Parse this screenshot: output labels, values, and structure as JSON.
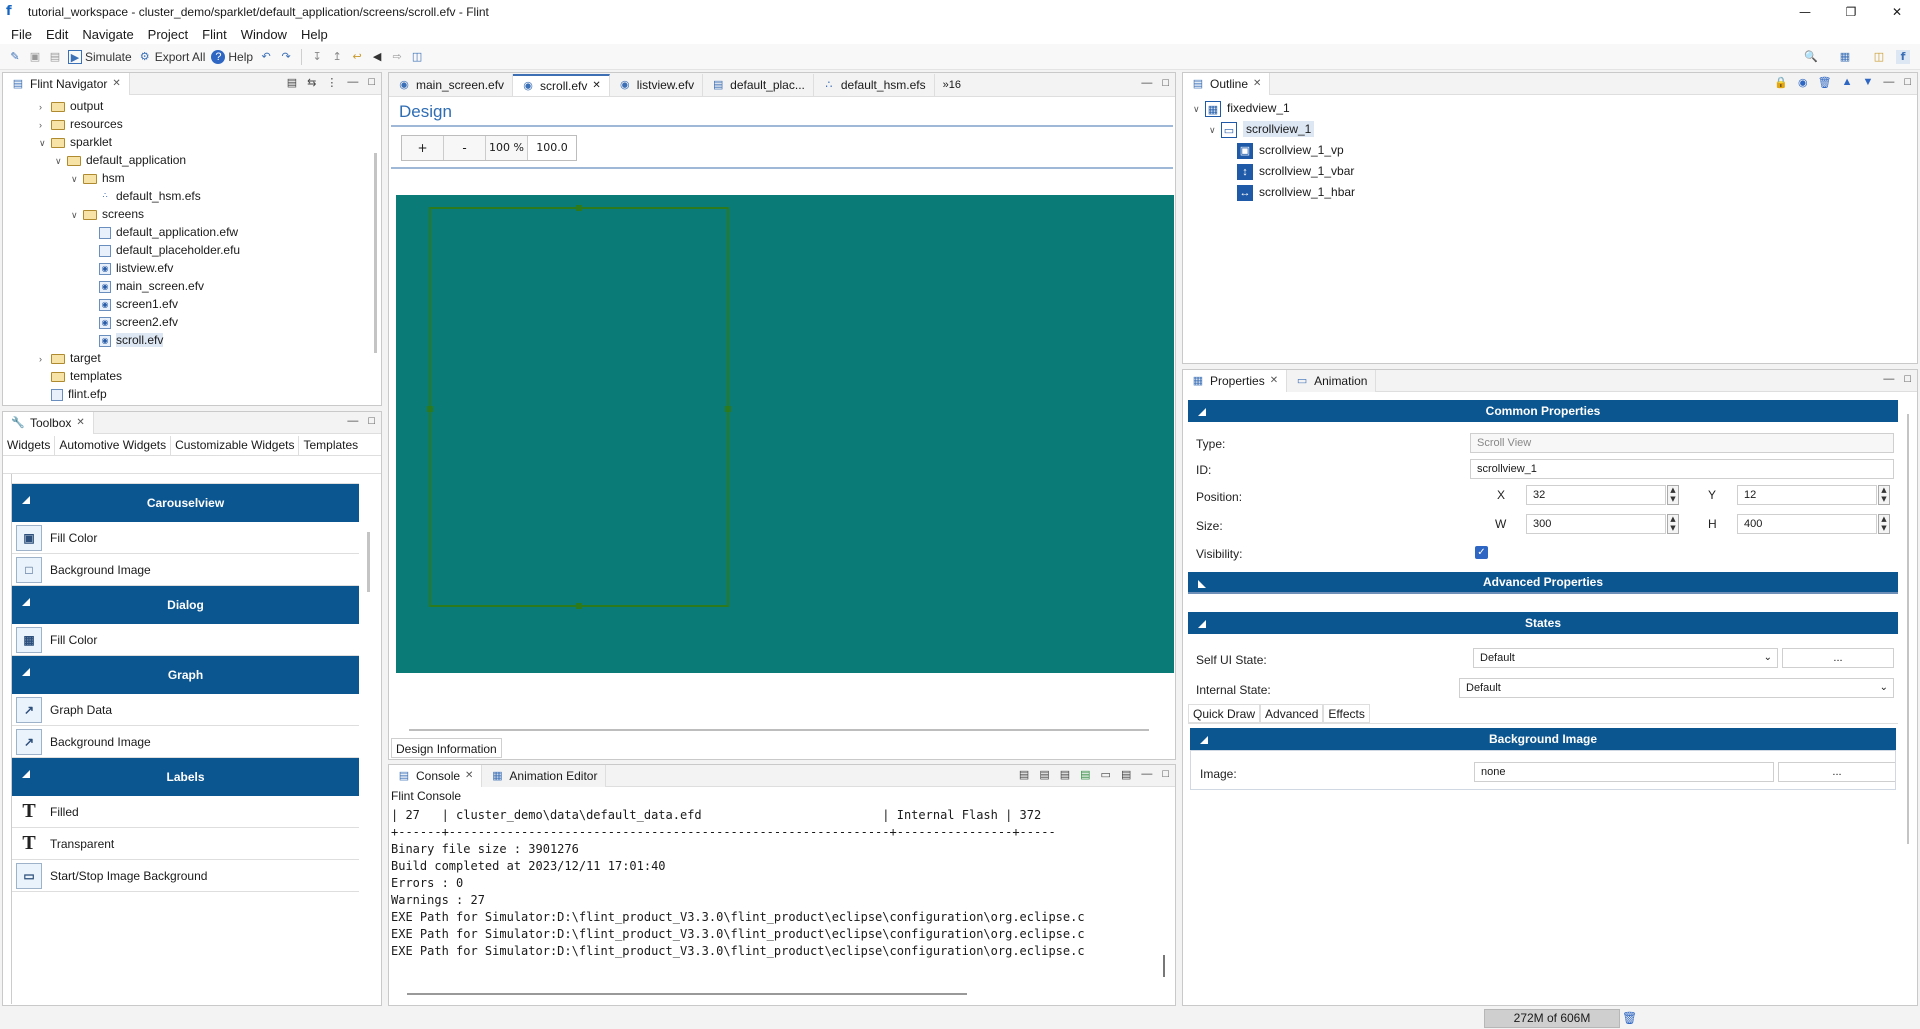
{
  "window": {
    "title": "tutorial_workspace - cluster_demo/sparklet/default_application/screens/scroll.efv - Flint"
  },
  "menu": [
    "File",
    "Edit",
    "Navigate",
    "Project",
    "Flint",
    "Window",
    "Help"
  ],
  "toolbar": {
    "simulate": "Simulate",
    "export_all": "Export All",
    "help": "Help"
  },
  "navigator": {
    "title": "Flint Navigator",
    "items": [
      {
        "label": "output",
        "depth": 1,
        "kind": "folder",
        "arrow": "right"
      },
      {
        "label": "resources",
        "depth": 1,
        "kind": "folder",
        "arrow": "right"
      },
      {
        "label": "sparklet",
        "depth": 1,
        "kind": "folder",
        "arrow": "down"
      },
      {
        "label": "default_application",
        "depth": 2,
        "kind": "folder",
        "arrow": "down"
      },
      {
        "label": "hsm",
        "depth": 3,
        "kind": "folder",
        "arrow": "down"
      },
      {
        "label": "default_hsm.efs",
        "depth": 4,
        "kind": "hsm"
      },
      {
        "label": "screens",
        "depth": 3,
        "kind": "folder",
        "arrow": "down"
      },
      {
        "label": "default_application.efw",
        "depth": 4,
        "kind": "file"
      },
      {
        "label": "default_placeholder.efu",
        "depth": 4,
        "kind": "file"
      },
      {
        "label": "listview.efv",
        "depth": 4,
        "kind": "view"
      },
      {
        "label": "main_screen.efv",
        "depth": 4,
        "kind": "view"
      },
      {
        "label": "screen1.efv",
        "depth": 4,
        "kind": "view"
      },
      {
        "label": "screen2.efv",
        "depth": 4,
        "kind": "view"
      },
      {
        "label": "scroll.efv",
        "depth": 4,
        "kind": "view",
        "selected": true
      },
      {
        "label": "target",
        "depth": 1,
        "kind": "folder",
        "arrow": "right"
      },
      {
        "label": "templates",
        "depth": 1,
        "kind": "folder"
      },
      {
        "label": "flint.efp",
        "depth": 1,
        "kind": "file"
      }
    ]
  },
  "editor": {
    "tabs": [
      "main_screen.efv",
      "scroll.efv",
      "listview.efv",
      "default_plac...",
      "default_hsm.efs"
    ],
    "overflow": "»16",
    "heading": "Design",
    "zoom_in": "+",
    "zoom_out": "-",
    "zoom_pct": "100 %",
    "zoom_value": "100.0",
    "bottom_tab": "Design Information",
    "canvas_color": "#0b7b78"
  },
  "toolbox": {
    "title": "Toolbox",
    "tabs": [
      "Widgets",
      "Automotive Widgets",
      "Customizable Widgets",
      "Templates"
    ],
    "categories": [
      {
        "name": "Carouselview",
        "items": [
          {
            "icon": "fill-color-icon",
            "label": "Fill Color"
          },
          {
            "icon": "background-image-icon",
            "label": "Background Image"
          }
        ]
      },
      {
        "name": "Dialog",
        "items": [
          {
            "icon": "dialog-fill-icon",
            "label": "Fill Color"
          }
        ]
      },
      {
        "name": "Graph",
        "items": [
          {
            "icon": "graph-icon",
            "label": "Graph Data"
          },
          {
            "icon": "graph-icon",
            "label": "Background Image"
          }
        ]
      },
      {
        "name": "Labels",
        "items": [
          {
            "icon": "text-icon",
            "label": "Filled"
          },
          {
            "icon": "text-icon",
            "label": "Transparent"
          },
          {
            "icon": "image-bg-icon",
            "label": "Start/Stop Image Background"
          }
        ]
      }
    ]
  },
  "console": {
    "tabs": [
      "Console",
      "Animation Editor"
    ],
    "header": "Flint Console",
    "lines": [
      "| 27   | cluster_demo\\data\\default_data.efd                         | Internal Flash | 372",
      "+------+-------------------------------------------------------------+----------------+-----",
      "Binary file size : 3901276",
      "Build completed at 2023/12/11 17:01:40",
      "Errors : 0",
      "Warnings : 27",
      "EXE Path for Simulator:D:\\flint_product_V3.3.0\\flint_product\\eclipse\\configuration\\org.eclipse.c",
      "EXE Path for Simulator:D:\\flint_product_V3.3.0\\flint_product\\eclipse\\configuration\\org.eclipse.c",
      "EXE Path for Simulator:D:\\flint_product_V3.3.0\\flint_product\\eclipse\\configuration\\org.eclipse.c"
    ]
  },
  "outline": {
    "title": "Outline",
    "items": [
      {
        "label": "fixedview_1",
        "depth": 0
      },
      {
        "label": "scrollview_1",
        "depth": 1,
        "selected": true
      },
      {
        "label": "scrollview_1_vp",
        "depth": 2
      },
      {
        "label": "scrollview_1_vbar",
        "depth": 2
      },
      {
        "label": "scrollview_1_hbar",
        "depth": 2
      }
    ]
  },
  "properties": {
    "tabs": [
      "Properties",
      "Animation"
    ],
    "common_header": "Common Properties",
    "type_label": "Type:",
    "type_value": "Scroll View",
    "id_label": "ID:",
    "id_value": "scrollview_1",
    "position_label": "Position:",
    "x_label": "X",
    "x_value": "32",
    "y_label": "Y",
    "y_value": "12",
    "size_label": "Size:",
    "w_label": "W",
    "w_value": "300",
    "h_label": "H",
    "h_value": "400",
    "visibility_label": "Visibility:",
    "advanced_header": "Advanced Properties",
    "states_header": "States",
    "self_ui_label": "Self UI State:",
    "self_ui_value": "Default",
    "ellipsis": "...",
    "internal_label": "Internal State:",
    "internal_value": "Default",
    "sub_tabs": [
      "Quick Draw",
      "Advanced",
      "Effects"
    ],
    "bg_header": "Background Image",
    "image_label": "Image:",
    "image_value": "none"
  },
  "status": {
    "memory": "272M of 606M"
  }
}
